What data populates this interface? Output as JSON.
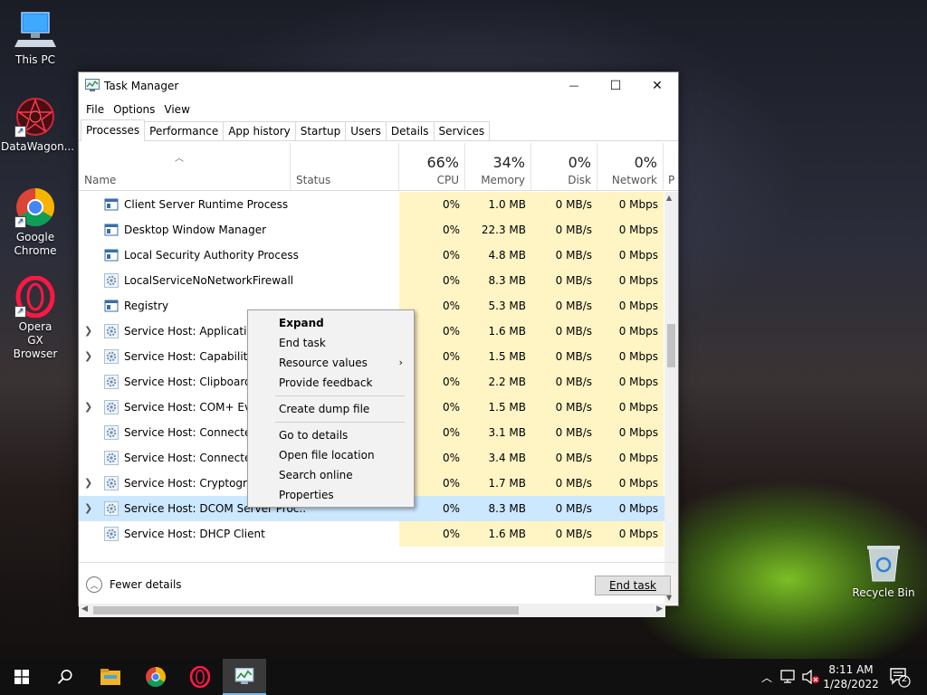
{
  "desktop": {
    "icons": [
      {
        "label": "This PC"
      },
      {
        "label": "DataWagon..."
      },
      {
        "label": "Google Chrome"
      },
      {
        "label": "Opera GX Browser"
      }
    ],
    "recycle_bin": {
      "label": "Recycle Bin"
    }
  },
  "window": {
    "title": "Task Manager",
    "caption": {
      "minimize": "—",
      "maximize": "☐",
      "close": "✕"
    },
    "menu": [
      "File",
      "Options",
      "View"
    ],
    "tabs": [
      "Processes",
      "Performance",
      "App history",
      "Startup",
      "Users",
      "Details",
      "Services"
    ],
    "active_tab": "Processes",
    "columns": {
      "name": "Name",
      "status": "Status",
      "cpu": {
        "percent": "66%",
        "label": "CPU"
      },
      "memory": {
        "percent": "34%",
        "label": "Memory"
      },
      "disk": {
        "percent": "0%",
        "label": "Disk"
      },
      "network": {
        "percent": "0%",
        "label": "Network"
      },
      "extra": "P"
    },
    "rows": [
      {
        "name": "Client Server Runtime Process",
        "icon": "window-icon",
        "expandable": false,
        "cpu": "0%",
        "memory": "1.0 MB",
        "disk": "0 MB/s",
        "network": "0 Mbps"
      },
      {
        "name": "Desktop Window Manager",
        "icon": "window-icon",
        "expandable": false,
        "cpu": "0%",
        "memory": "22.3 MB",
        "disk": "0 MB/s",
        "network": "0 Mbps"
      },
      {
        "name": "Local Security Authority Process",
        "icon": "window-icon",
        "expandable": false,
        "cpu": "0%",
        "memory": "4.8 MB",
        "disk": "0 MB/s",
        "network": "0 Mbps"
      },
      {
        "name": "LocalServiceNoNetworkFirewall",
        "icon": "gear-icon",
        "expandable": false,
        "cpu": "0%",
        "memory": "8.3 MB",
        "disk": "0 MB/s",
        "network": "0 Mbps"
      },
      {
        "name": "Registry",
        "icon": "window-icon",
        "expandable": false,
        "cpu": "0%",
        "memory": "5.3 MB",
        "disk": "0 MB/s",
        "network": "0 Mbps"
      },
      {
        "name": "Service Host: Application",
        "icon": "gear-icon",
        "expandable": true,
        "cpu": "0%",
        "memory": "1.6 MB",
        "disk": "0 MB/s",
        "network": "0 Mbps"
      },
      {
        "name": "Service Host: Capability A",
        "icon": "gear-icon",
        "expandable": true,
        "cpu": "0%",
        "memory": "1.5 MB",
        "disk": "0 MB/s",
        "network": "0 Mbps"
      },
      {
        "name": "Service Host: Clipboard Us",
        "icon": "gear-icon",
        "expandable": false,
        "cpu": "0%",
        "memory": "2.2 MB",
        "disk": "0 MB/s",
        "network": "0 Mbps"
      },
      {
        "name": "Service Host: COM+ Even",
        "icon": "gear-icon",
        "expandable": true,
        "cpu": "0%",
        "memory": "1.5 MB",
        "disk": "0 MB/s",
        "network": "0 Mbps"
      },
      {
        "name": "Service Host: Connected D",
        "icon": "gear-icon",
        "expandable": false,
        "cpu": "0%",
        "memory": "3.1 MB",
        "disk": "0 MB/s",
        "network": "0 Mbps"
      },
      {
        "name": "Service Host: Connected D",
        "icon": "gear-icon",
        "expandable": false,
        "cpu": "0%",
        "memory": "3.4 MB",
        "disk": "0 MB/s",
        "network": "0 Mbps"
      },
      {
        "name": "Service Host: Cryptograph",
        "icon": "gear-icon",
        "expandable": true,
        "cpu": "0%",
        "memory": "1.7 MB",
        "disk": "0 MB/s",
        "network": "0 Mbps"
      },
      {
        "name": "Service Host: DCOM Server Proc...",
        "icon": "gear-icon",
        "expandable": true,
        "selected": true,
        "cpu": "0%",
        "memory": "8.3 MB",
        "disk": "0 MB/s",
        "network": "0 Mbps"
      },
      {
        "name": "Service Host: DHCP Client",
        "icon": "gear-icon",
        "expandable": false,
        "cpu": "0%",
        "memory": "1.6 MB",
        "disk": "0 MB/s",
        "network": "0 Mbps"
      }
    ],
    "footer": {
      "fewer_details": "Fewer details",
      "end_task": "End task"
    }
  },
  "context_menu": {
    "items": [
      {
        "label": "Expand",
        "bold": true
      },
      {
        "label": "End task"
      },
      {
        "label": "Resource values",
        "submenu": true
      },
      {
        "label": "Provide feedback"
      },
      {
        "separator": true
      },
      {
        "label": "Create dump file"
      },
      {
        "separator": true
      },
      {
        "label": "Go to details"
      },
      {
        "label": "Open file location"
      },
      {
        "label": "Search online"
      },
      {
        "label": "Properties"
      }
    ]
  },
  "taskbar": {
    "clock_time": "8:11 AM",
    "clock_date": "1/28/2022",
    "notification_count": "2"
  },
  "colors": {
    "heat_column": "#fff4c4",
    "selection": "#cce8ff",
    "accent": "#76b9ed"
  }
}
